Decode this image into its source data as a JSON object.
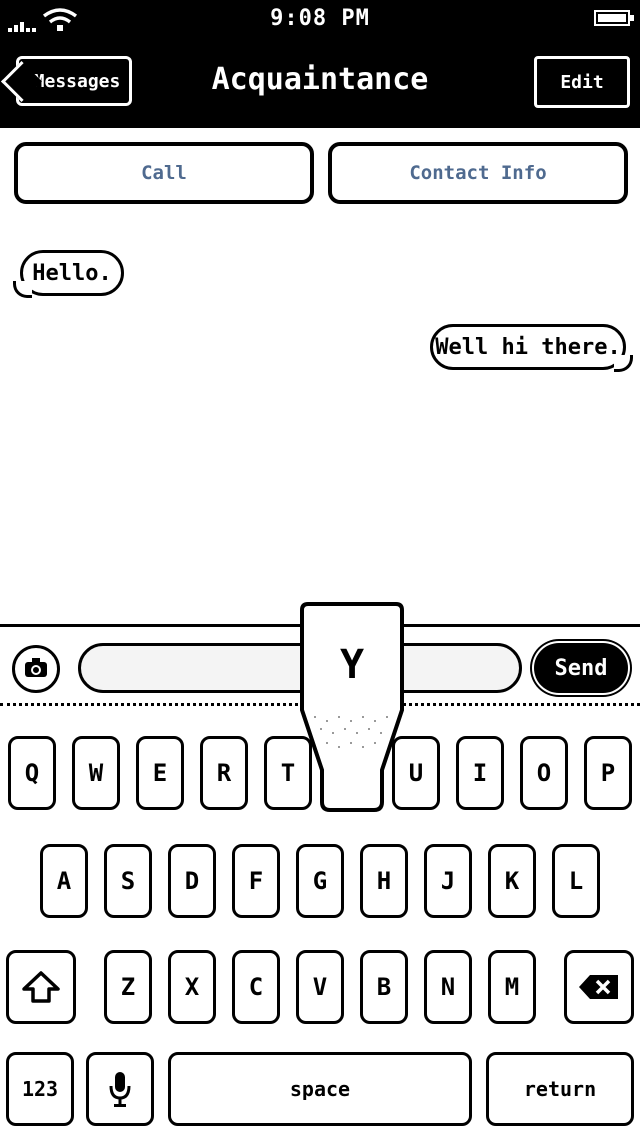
{
  "status_bar": {
    "time": "9:08 PM"
  },
  "nav": {
    "back_label": "Messages",
    "title": "Acquaintance",
    "edit_label": "Edit"
  },
  "actions": {
    "call_label": "Call",
    "contact_label": "Contact Info"
  },
  "messages": [
    {
      "text": "Hello.",
      "direction": "incoming"
    },
    {
      "text": "Well hi there.",
      "direction": "outgoing"
    }
  ],
  "composer": {
    "placeholder": "",
    "send_label": "Send"
  },
  "keyboard": {
    "row1": [
      "Q",
      "W",
      "E",
      "R",
      "T",
      "Y",
      "U",
      "I",
      "O",
      "P"
    ],
    "row2": [
      "A",
      "S",
      "D",
      "F",
      "G",
      "H",
      "J",
      "K",
      "L"
    ],
    "row3": [
      "Z",
      "X",
      "C",
      "V",
      "B",
      "N",
      "M"
    ],
    "numbers_label": "123",
    "space_label": "space",
    "return_label": "return",
    "pressed_key": "Y"
  },
  "colors": {
    "accent_text": "#4f6a8f",
    "bar_background": "#000000"
  }
}
